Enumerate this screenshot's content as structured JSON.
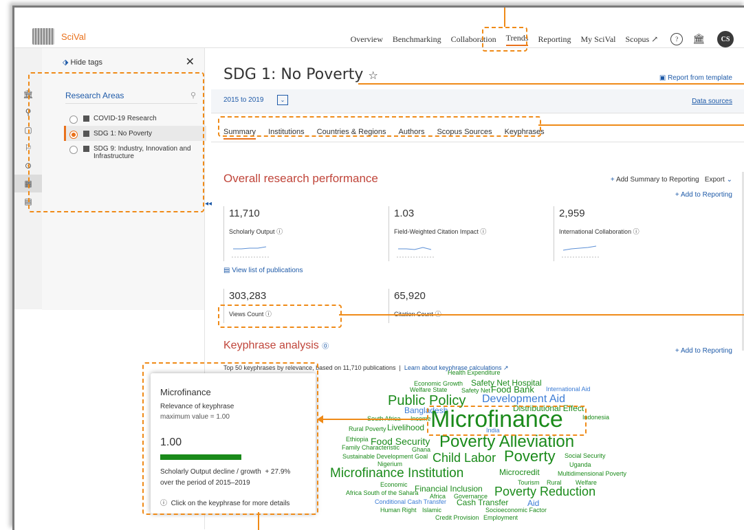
{
  "nav": {
    "logo": "SciVal",
    "links": [
      "Overview",
      "Benchmarking",
      "Collaboration",
      "Trends",
      "Reporting",
      "My SciVal",
      "Scopus ↗"
    ],
    "active": "Trends",
    "help_icon": "question-icon",
    "institution_icon": "institution-icon",
    "avatar": "CS"
  },
  "rail": {
    "icons": [
      "institution-icon",
      "person-icon",
      "document-icon",
      "flag-icon",
      "target-icon",
      "grid-icon",
      "journal-icon"
    ]
  },
  "left": {
    "hide_tags": "Hide tags",
    "section_title": "Research Areas",
    "items": [
      {
        "label": "COVID-19 Research",
        "selected": false
      },
      {
        "label": "SDG 1: No Poverty",
        "selected": true
      },
      {
        "label": "SDG 9: Industry, Innovation and",
        "label2": "Infrastructure",
        "selected": false
      }
    ]
  },
  "main": {
    "title": "SDG 1: No Poverty",
    "star": "☆",
    "report_from_template": "Report from template",
    "date_range": "2015 to 2019",
    "data_sources": "Data sources",
    "tabs": [
      "Summary",
      "Institutions",
      "Countries & Regions",
      "Authors",
      "Scopus Sources",
      "Keyphrases"
    ],
    "add_summary": "Add Summary to Reporting",
    "export": "Export",
    "overall_title": "Overall research performance",
    "add_to_reporting": "Add to Reporting",
    "metrics": [
      {
        "value": "11,710",
        "label": "Scholarly Output"
      },
      {
        "value": "1.03",
        "label": "Field-Weighted Citation Impact"
      },
      {
        "value": "2,959",
        "label": "International Collaboration"
      },
      {
        "value": "303,283",
        "label": "Views Count"
      },
      {
        "value": "65,920",
        "label": "Citation Count"
      }
    ],
    "view_list": "View list of publications",
    "kp_title": "Keyphrase analysis",
    "kp_add": "Add to Reporting",
    "kp_sub": "Top 50 keyphrases by relevance, based on 11,710 publications",
    "kp_learn": "Learn about keyphrase calculations ↗"
  },
  "tooltip": {
    "term": "Microfinance",
    "relevance": "Relevance of keyphrase",
    "max": "maximum value = 1.00",
    "value": "1.00",
    "relevance_fraction": 1.0,
    "growth_label": "Scholarly Output decline / growth",
    "growth_value": "+ 27.9%",
    "period": "over the period of 2015–2019",
    "hint": "Click on the keyphrase for more details"
  },
  "cloud_words": [
    "Health Expenditure",
    "Economic Growth",
    "Safety Net Hospital",
    "Welfare State",
    "Safety Net",
    "Food Bank",
    "International Aid",
    "Public Policy",
    "Development Aid",
    "Bangladesh",
    "Distributional Effect",
    "South Africa",
    "Income",
    "Microfinance",
    "Indonesia",
    "Rural Poverty",
    "Livelihood",
    "India",
    "Food Security",
    "Poverty Alleviation",
    "Ethiopia",
    "Family Characteristic",
    "Ghana",
    "Sustainable Development Goal",
    "Child Labor",
    "Poverty",
    "Social Security",
    "Nigerium",
    "Uganda",
    "Microfinance Institution",
    "Microcredit",
    "Multidimensional Poverty",
    "Economic",
    "Tourism",
    "Rural",
    "Welfare",
    "Financial Inclusion",
    "Africa South of the Sahara",
    "Africa",
    "Governance",
    "Poverty Reduction",
    "Conditional Cash Transfer",
    "Cash Transfer",
    "Aid",
    "Human Right",
    "Islamic",
    "Socioeconomic Factor",
    "Credit Provision",
    "Employment"
  ]
}
